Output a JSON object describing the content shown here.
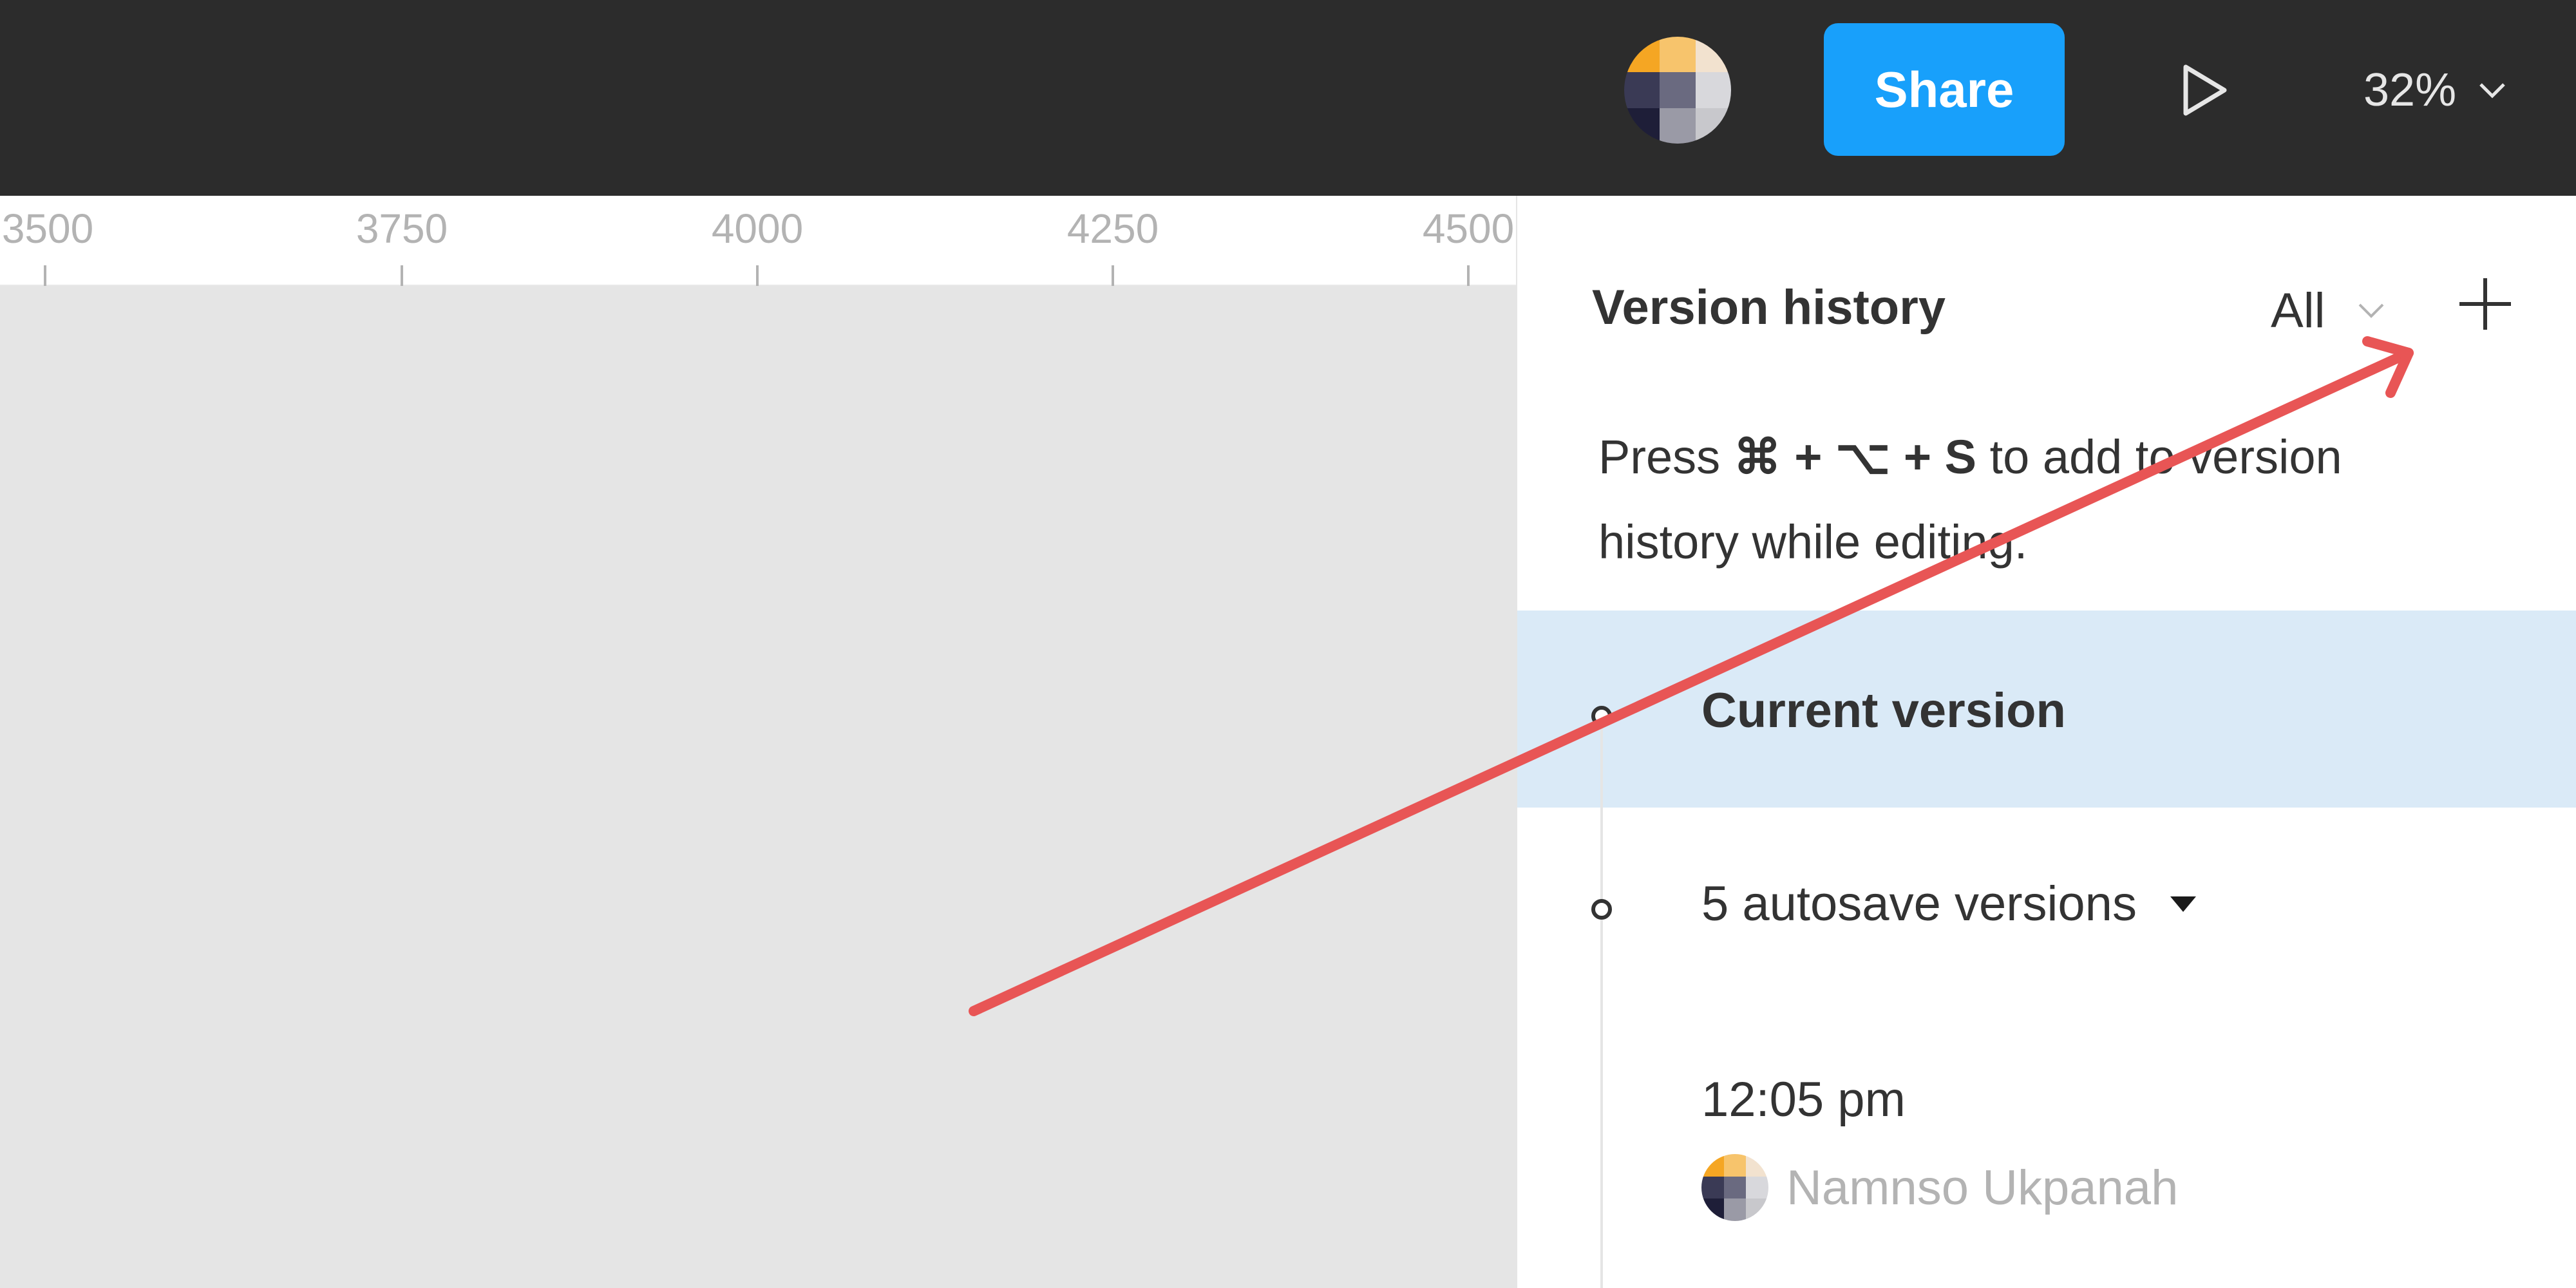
{
  "toolbar": {
    "share_label": "Share",
    "zoom_level": "32%",
    "avatar_colors": [
      "#f5a623",
      "#f7c46c",
      "#f2e2cf",
      "#3a3a55",
      "#6a6a80",
      "#d8d8dc",
      "#1e1e38",
      "#9a9aa6",
      "#c8c8cc"
    ],
    "accent_color": "#18a0fb"
  },
  "canvas": {
    "ruler_labels": [
      "3500",
      "3750",
      "4000",
      "4250",
      "4500"
    ],
    "background_color": "#e5e5e5"
  },
  "version_history": {
    "title": "Version history",
    "filter_label": "All",
    "hint": {
      "before": "Press ",
      "shortcut": "⌘ + ⌥ + S",
      "after": " to add to version history while editing."
    },
    "current_version_label": "Current version",
    "autosave_label": "5 autosave versions",
    "entries": [
      {
        "time": "12:05 pm",
        "user": "Namnso Ukpanah"
      }
    ],
    "selected_row_color": "#daeaf7"
  },
  "annotation": {
    "color": "#e85555"
  }
}
